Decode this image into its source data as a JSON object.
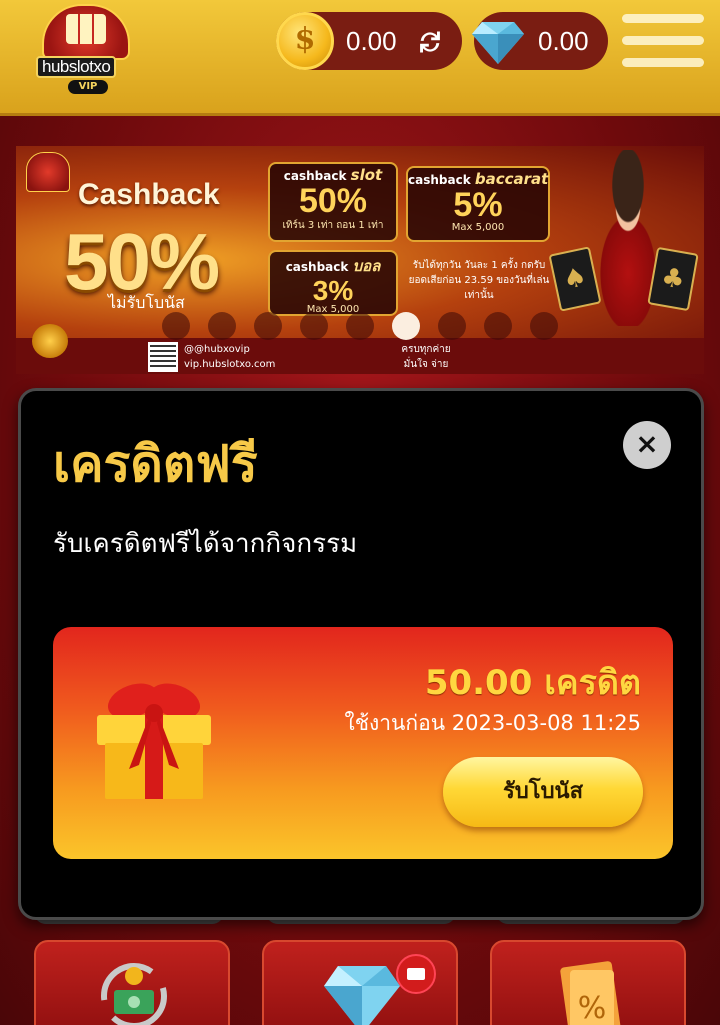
{
  "header": {
    "logo_text": "hubslotxo",
    "logo_badge": "VIP",
    "credit_balance": "0.00",
    "diamond_balance": "0.00",
    "icons": {
      "coin": "coin-icon",
      "refresh": "refresh-icon",
      "diamond": "diamond-icon",
      "menu": "hamburger-menu-icon"
    }
  },
  "banner": {
    "title": "Cashback",
    "percent": "50%",
    "note": "ไม่รับโบนัส",
    "boxes": [
      {
        "label_prefix": "cashback",
        "label_game": "slot",
        "value": "50%",
        "sub": "เทิร์น 3 เท่า ถอน 1 เท่า"
      },
      {
        "label_prefix": "cashback",
        "label_game": "baccarat",
        "value": "5%",
        "sub": "Max 5,000"
      },
      {
        "label_prefix": "cashback",
        "label_game": "บอล",
        "value": "3%",
        "sub": "Max 5,000"
      }
    ],
    "conditions": "รับได้ทุกวัน วันละ 1 ครั้ง กดรับยอดเสียก่อน 23.59 ของวันที่เล่นเท่านั้น",
    "contact_line": "@@hubxovip",
    "contact_web": "vip.hubslotxo.com",
    "slogan_1": "ครบทุกค่าย",
    "slogan_2": "มั่นใจ จ่ายจริง",
    "carousel": {
      "count": 9,
      "active_index": 5
    }
  },
  "modal": {
    "title": "เครดิตฟรี",
    "subtitle": "รับเครดิตฟรีได้จากกิจกรรม",
    "close_label": "×",
    "card": {
      "amount": "50.00 เครดิต",
      "expiry": "ใช้งานก่อน 2023-03-08 11:25",
      "claim_label": "รับโบนัส",
      "icon": "gift-box-icon"
    }
  },
  "tiles": [
    {
      "icon": "cash-refund-icon"
    },
    {
      "icon": "diamond-mail-icon"
    },
    {
      "icon": "coupon-icon"
    }
  ],
  "colors": {
    "header_gold": "#f2c83a",
    "modal_bg": "#000000",
    "title_yellow": "#f7c948",
    "card_red": "#e2261d",
    "button_gold": "#ffd836"
  }
}
